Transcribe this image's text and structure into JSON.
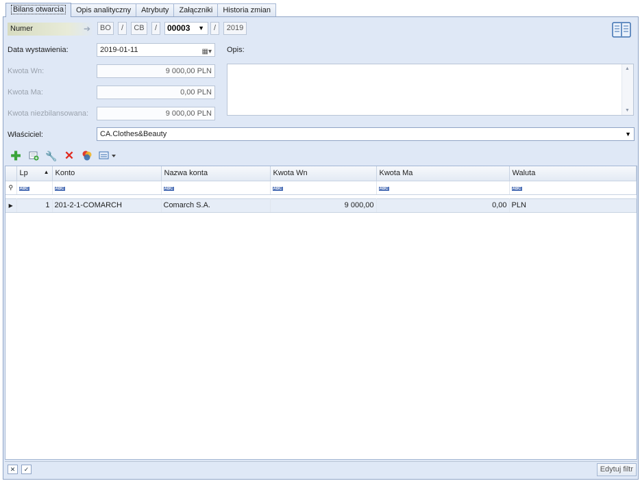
{
  "tabs": [
    "Bilans otwarcia",
    "Opis analityczny",
    "Atrybuty",
    "Załączniki",
    "Historia zmian"
  ],
  "numer": {
    "label": "Numer",
    "seg1": "BO",
    "slash": "/",
    "seg2": "CB",
    "seg3": "00003",
    "seg4": "2019"
  },
  "form": {
    "data_label": "Data wystawienia:",
    "data_value": "2019-01-11",
    "opis_label": "Opis:",
    "kwota_wn_label": "Kwota Wn:",
    "kwota_wn_value": "9 000,00 PLN",
    "kwota_ma_label": "Kwota Ma:",
    "kwota_ma_value": "0,00 PLN",
    "kwota_niezb_label": "Kwota niezbilansowana:",
    "kwota_niezb_value": "9 000,00 PLN",
    "owner_label": "Właściciel:",
    "owner_value": "CA.Clothes&Beauty"
  },
  "toolbar_icons": [
    "add-icon",
    "add-from-list-icon",
    "edit-wrench-icon",
    "delete-icon",
    "color-icon",
    "export-icon"
  ],
  "grid": {
    "columns": [
      "Lp",
      "Konto",
      "Nazwa konta",
      "Kwota Wn",
      "Kwota Ma",
      "Waluta"
    ],
    "filter_placeholder": "ABC",
    "rows": [
      {
        "lp": "1",
        "konto": "201-2-1-COMARCH",
        "nazwa": "Comarch S.A.",
        "wn": "9 000,00",
        "ma": "0,00",
        "waluta": "PLN"
      }
    ]
  },
  "bottom": {
    "filter_button": "Edytuj filtr"
  }
}
